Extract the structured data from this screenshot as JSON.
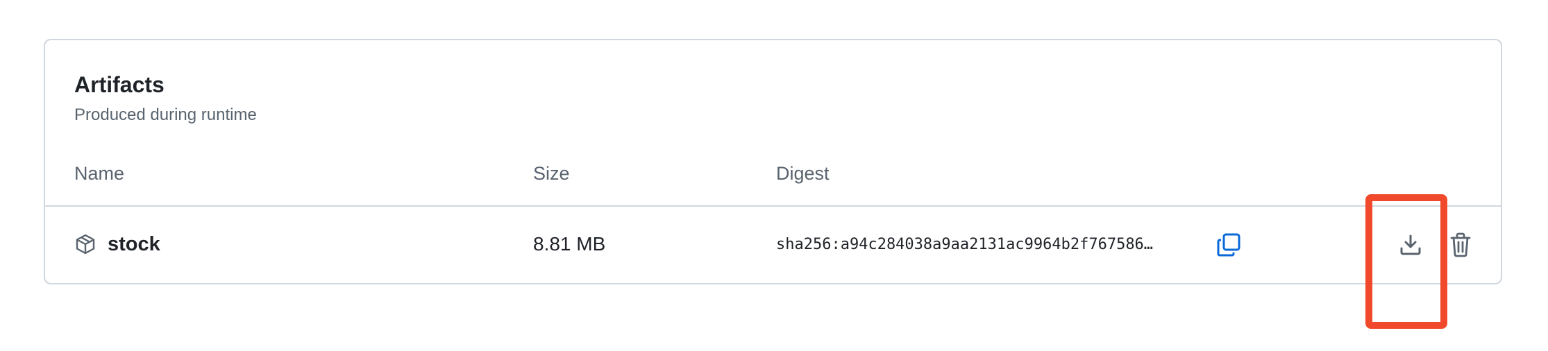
{
  "artifacts_panel": {
    "title": "Artifacts",
    "subtitle": "Produced during runtime",
    "columns": {
      "name": "Name",
      "size": "Size",
      "digest": "Digest"
    },
    "rows": [
      {
        "icon": "package-icon",
        "name": "stock",
        "size": "8.81 MB",
        "digest": "sha256:a94c284038a9aa2131ac9964b2f767586…",
        "actions": [
          "copy-icon",
          "download-icon",
          "trash-icon"
        ]
      }
    ]
  },
  "colors": {
    "text_primary": "#1f2328",
    "text_muted": "#59636e",
    "border": "#d0d7de",
    "link_blue": "#0969da",
    "highlight": "#f0492b"
  }
}
